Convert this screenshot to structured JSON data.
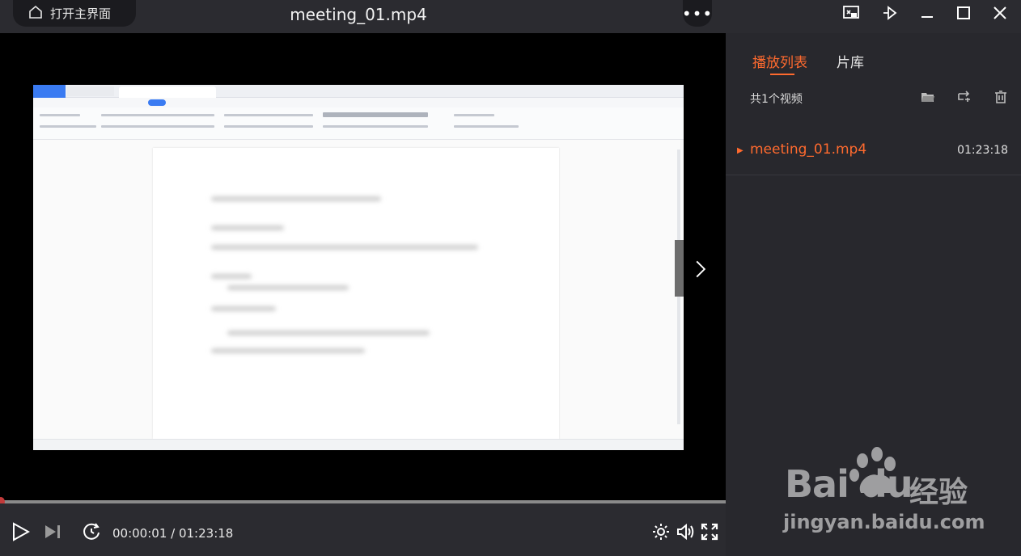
{
  "window": {
    "title": "meeting_01.mp4",
    "home_label": "打开主界面",
    "more_label": "•••"
  },
  "sidebar": {
    "tabs": [
      {
        "label": "播放列表",
        "active": true
      },
      {
        "label": "片库",
        "active": false
      }
    ],
    "count_label": "共1个视频",
    "playlist": [
      {
        "name": "meeting_01.mp4",
        "duration": "01:23:18"
      }
    ]
  },
  "player": {
    "current_time": "00:00:01",
    "separator": " / ",
    "total_time": "01:23:18",
    "progress": 0.0002
  },
  "watermark": {
    "brand": "Bai du",
    "suffix": "经验",
    "url": "jingyan.baidu.com"
  },
  "colors": {
    "accent": "#ff6a2e",
    "panel": "#28282d",
    "bar": "#2b2b30"
  }
}
